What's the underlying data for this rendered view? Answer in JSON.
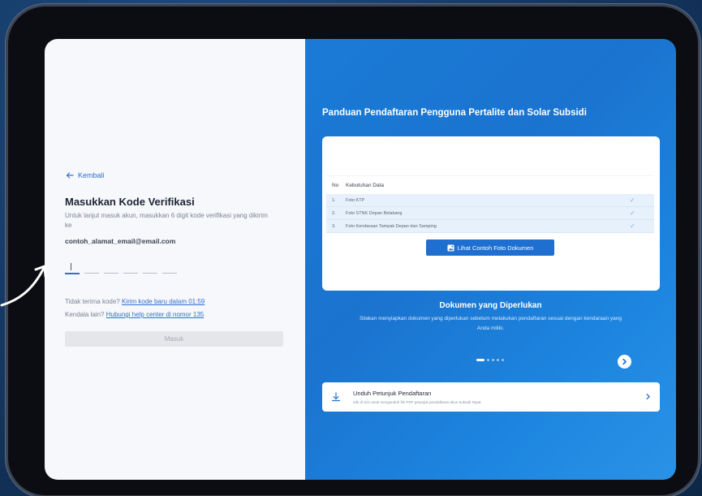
{
  "left": {
    "back_label": "Kembali",
    "title": "Masukkan Kode Verifikasi",
    "description": "Untuk lanjut masuk akun, masukkan 6 digit kode verifikasi yang dikirim ke",
    "email": "contoh_alamat_email@email.com",
    "resend_prefix": "Tidak terima kode?",
    "resend_link": "Kirim kode baru dalam 01:59",
    "help_prefix": "Kendala lain?",
    "help_link": "Hubungi help center di nomor 135",
    "submit_label": "Masuk"
  },
  "right": {
    "title": "Panduan Pendaftaran Pengguna Pertalite dan Solar Subsidi",
    "table": {
      "headers": [
        "No",
        "Kebutuhan Data"
      ],
      "rows": [
        {
          "no": "1.",
          "item": "Foto KTP"
        },
        {
          "no": "2.",
          "item": "Foto STNK Depan Belakang"
        },
        {
          "no": "3.",
          "item": "Foto Kendaraan Tampak Depan dan Samping"
        }
      ]
    },
    "sample_button": "Lihat Contoh Foto Dokumen",
    "section_title": "Dokumen yang Diperlukan",
    "section_desc": "Silakan menyiapkan dokumen yang diperlukan sebelum melakukan pendaftaran sesuai dengan kendaraan yang Anda miliki.",
    "download_title": "Unduh Petunjuk Pendaftaran",
    "download_desc": "Klik di sini untuk mengunduh file PDF petunjuk pendaftaran akun Subsidi Tepat."
  },
  "colors": {
    "accent": "#2e6fd0",
    "panel_blue": "#1a7bd6",
    "check": "#7aaee8"
  },
  "icons": {
    "back": "arrow-left-icon",
    "sample": "image-icon",
    "check": "check-icon",
    "next": "chevron-right-icon",
    "download": "download-icon"
  }
}
